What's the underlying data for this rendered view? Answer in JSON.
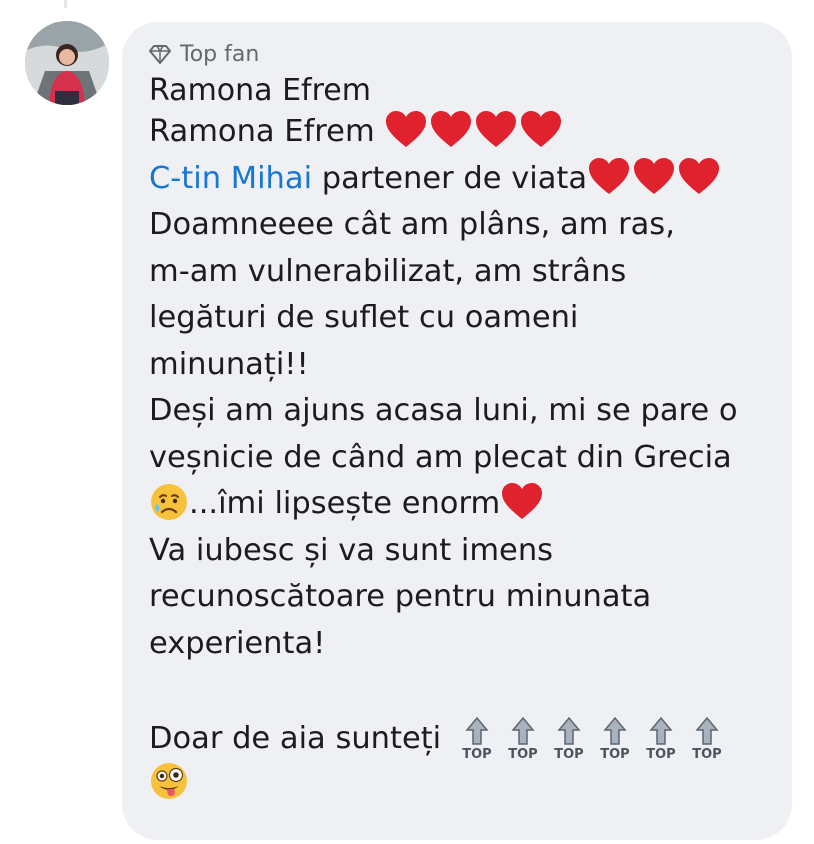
{
  "comment": {
    "badge": "Top fan",
    "author": "Ramona Efrem",
    "lines": {
      "l1": "Ramona Efrem ",
      "mention": "C-tin Mihai",
      "l2_after_mention": " partener de viata",
      "l3": " Doamneeee cât am plâns, am ras,",
      "l4": "m-am vulnerabilizat, am strâns",
      "l5": "legături de suflet cu oameni",
      "l6": "minunați!!",
      "l7": "Deși am ajuns acasa luni, mi se pare o",
      "l8": "veșnicie de când am plecat din Grecia",
      "l9": "...îmi lipsește enorm",
      "l10": "Va iubesc și va sunt imens",
      "l11": "recunoscătoare pentru minunata",
      "l12": "experienta!",
      "l13": "Doar de aia sunteți "
    },
    "top_icon_label": "TOP",
    "colors": {
      "bubble": "#eef0f4",
      "mention": "#1877d2",
      "heart": "#e0222e",
      "muted": "#65676b"
    },
    "icons": {
      "badge": "diamond-icon",
      "heart": "red-heart-emoji",
      "sad": "sad-but-relieved-face-emoji",
      "top": "top-arrow-emoji",
      "silly": "zany-face-emoji"
    }
  }
}
